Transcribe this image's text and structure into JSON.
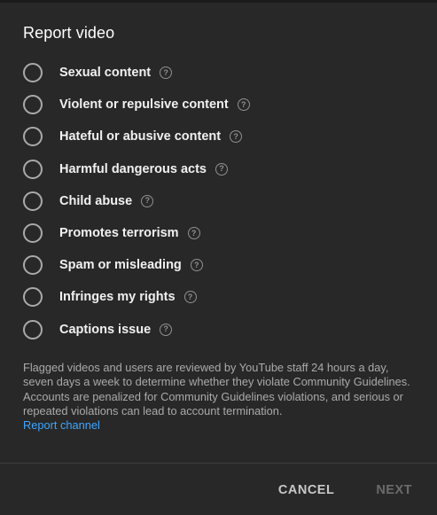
{
  "dialog": {
    "title": "Report video",
    "options": [
      {
        "label": "Sexual content",
        "help_icon": "help-circle-icon"
      },
      {
        "label": "Violent or repulsive content",
        "help_icon": "help-circle-icon"
      },
      {
        "label": "Hateful or abusive content",
        "help_icon": "help-circle-icon"
      },
      {
        "label": "Harmful dangerous acts",
        "help_icon": "help-circle-icon"
      },
      {
        "label": "Child abuse",
        "help_icon": "help-circle-icon"
      },
      {
        "label": "Promotes terrorism",
        "help_icon": "help-circle-icon"
      },
      {
        "label": "Spam or misleading",
        "help_icon": "help-circle-icon"
      },
      {
        "label": "Infringes my rights",
        "help_icon": "help-circle-icon"
      },
      {
        "label": "Captions issue",
        "help_icon": "help-circle-icon"
      }
    ],
    "disclaimer": "Flagged videos and users are reviewed by YouTube staff 24 hours a day, seven days a week to determine whether they violate Community Guidelines. Accounts are penalized for Community Guidelines violations, and serious or repeated violations can lead to account termination.",
    "report_channel_link": "Report channel",
    "cancel_label": "CANCEL",
    "next_label": "NEXT",
    "help_glyph": "?"
  },
  "colors": {
    "background": "#282828",
    "text": "#f1f1f1",
    "muted_text": "#aaaaaa",
    "link": "#3ea6ff",
    "disabled": "#6b6b6b"
  }
}
